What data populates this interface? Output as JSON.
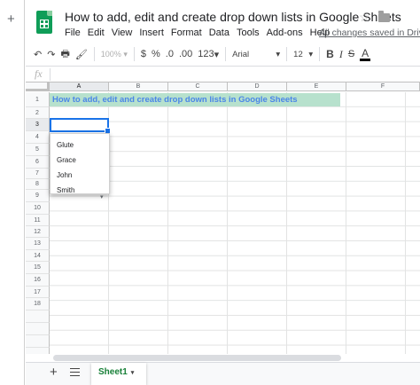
{
  "outer": {
    "new_tab_glyph": "+"
  },
  "header": {
    "doc_title": "How to add, edit and create drop down lists in Google Sheets",
    "star_glyph": "☆",
    "save_status": "All changes saved in Drive"
  },
  "menu": [
    "File",
    "Edit",
    "View",
    "Insert",
    "Format",
    "Data",
    "Tools",
    "Add-ons",
    "Help"
  ],
  "toolbar": {
    "undo": "↶",
    "redo": "↷",
    "print": "🖶",
    "paint_format": "🖌",
    "zoom": "100%",
    "zoom_caret": "▾",
    "currency": "$",
    "percent": "%",
    "decrease_decimal": ".0",
    "increase_decimal": ".00",
    "more_formats": "123",
    "more_formats_caret": "▾",
    "font": "Arial",
    "font_caret": "▾",
    "font_size": "12",
    "font_size_caret": "▾",
    "bold": "B",
    "italic": "I",
    "strikethrough": "S",
    "text_color": "A"
  },
  "formula_bar": {
    "fx_label": "fx",
    "value": ""
  },
  "grid": {
    "columns": [
      "A",
      "B",
      "C",
      "D",
      "E",
      "F"
    ],
    "rows": [
      "1",
      "2",
      "3",
      "4",
      "5",
      "6",
      "7",
      "8",
      "9",
      "10",
      "11",
      "12",
      "13",
      "14",
      "15",
      "16",
      "17",
      "18"
    ],
    "active_cell": "A3",
    "cell_a1": "How to add, edit and create drop down lists in Google Sheets",
    "cell_a1_fill": "#b7e1cd",
    "cell_a1_color": "#4a86e8"
  },
  "dropdown": {
    "options": [
      "Glute",
      "Grace",
      "John",
      "Smith"
    ],
    "arrow_glyph": "▾"
  },
  "sheets": {
    "add_glyph": "+",
    "tabs": [
      {
        "label": "Sheet1",
        "caret": "▾",
        "active": true
      }
    ]
  },
  "colors": {
    "accent": "#1a73e8",
    "brand_green": "#0f9d58",
    "sheet_tab_green": "#188038"
  }
}
